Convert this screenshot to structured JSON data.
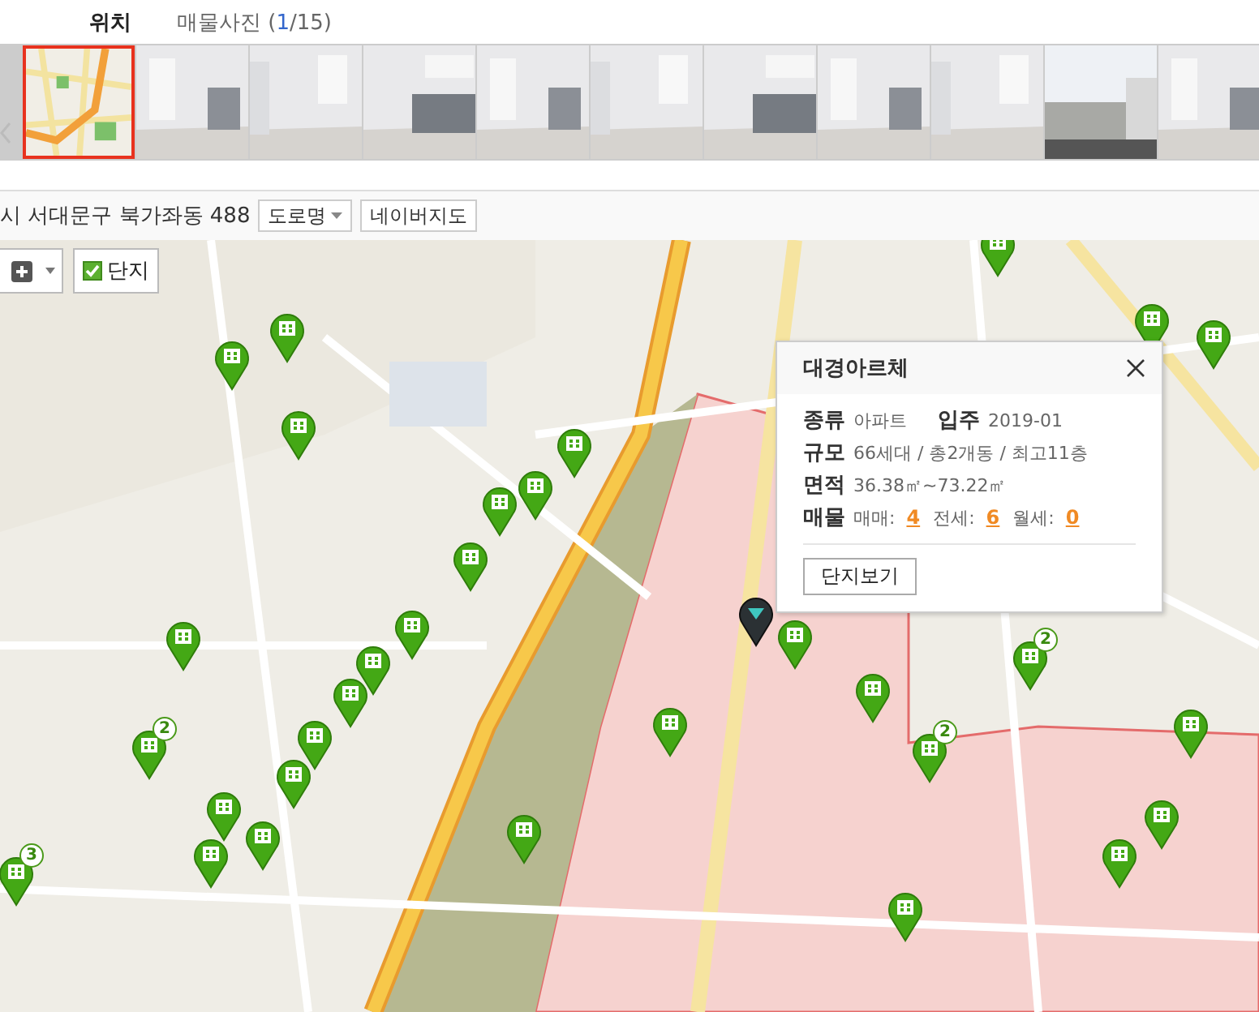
{
  "tabs": [
    {
      "label": "위치",
      "selected": true
    },
    {
      "label": "매물사진",
      "selected": false,
      "count_prefix": "(",
      "current": "1",
      "count_suffix": "/15)"
    }
  ],
  "photo_strip": {
    "thumbnails": [
      {
        "kind": "map",
        "selected": true
      },
      {
        "kind": "room",
        "selected": false
      },
      {
        "kind": "room",
        "selected": false
      },
      {
        "kind": "room",
        "selected": false
      },
      {
        "kind": "room",
        "selected": false
      },
      {
        "kind": "room",
        "selected": false
      },
      {
        "kind": "room",
        "selected": false
      },
      {
        "kind": "room",
        "selected": false
      },
      {
        "kind": "room",
        "selected": false
      },
      {
        "kind": "view",
        "selected": false
      },
      {
        "kind": "room",
        "selected": false
      }
    ]
  },
  "address_bar": {
    "address": "시 서대문구 북가좌동 488",
    "road_name_button": "도로명",
    "map_link_button": "네이버지도"
  },
  "map": {
    "kind": "picture",
    "complex_filter": {
      "label": "단지",
      "checked": true
    },
    "pins": [
      {
        "kind": "complex"
      },
      {
        "kind": "complex"
      },
      {
        "kind": "complex"
      },
      {
        "kind": "complex"
      },
      {
        "kind": "complex"
      },
      {
        "kind": "complex"
      },
      {
        "kind": "complex"
      },
      {
        "kind": "complex"
      },
      {
        "kind": "complex"
      },
      {
        "kind": "complex"
      },
      {
        "kind": "complex"
      },
      {
        "kind": "complex"
      },
      {
        "kind": "complex"
      },
      {
        "kind": "complex"
      },
      {
        "kind": "complex"
      },
      {
        "kind": "complex"
      },
      {
        "kind": "complex"
      },
      {
        "kind": "complex"
      },
      {
        "kind": "complex"
      },
      {
        "kind": "complex",
        "badge": "2"
      },
      {
        "kind": "complex"
      },
      {
        "kind": "complex"
      },
      {
        "kind": "complex"
      },
      {
        "kind": "complex"
      },
      {
        "kind": "complex"
      },
      {
        "kind": "complex"
      },
      {
        "kind": "complex"
      },
      {
        "kind": "complex"
      },
      {
        "kind": "complex",
        "badge": "2"
      },
      {
        "kind": "complex",
        "badge": "2"
      },
      {
        "kind": "complex",
        "badge": "3"
      },
      {
        "kind": "selected"
      }
    ],
    "info_popup": {
      "title": "대경아르체",
      "rows": [
        {
          "kind": "text",
          "fields": [
            {
              "label": "종류",
              "value": "아파트"
            },
            {
              "label": "입주",
              "value": "2019-01"
            }
          ]
        },
        {
          "kind": "text",
          "fields": [
            {
              "label": "규모",
              "value": "66세대 / 총2개동 / 최고11층"
            }
          ]
        },
        {
          "kind": "text",
          "fields": [
            {
              "label": "면적",
              "value": "36.38㎡~73.22㎡"
            }
          ]
        },
        {
          "kind": "counts",
          "label": "매물",
          "counts": [
            {
              "label": "매매:",
              "count": "4"
            },
            {
              "label": "전세:",
              "count": "6"
            },
            {
              "label": "월세:",
              "count": "0"
            }
          ]
        }
      ],
      "button": "단지보기"
    }
  }
}
